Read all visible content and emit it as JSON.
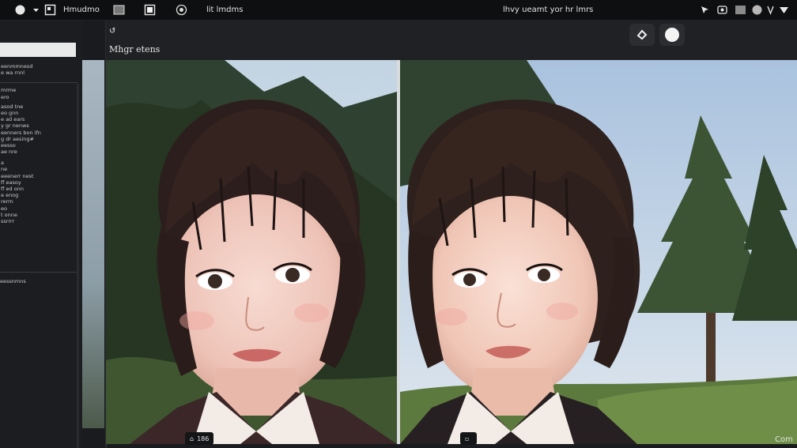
{
  "menubar": {
    "items": [
      "Hmudmo",
      "lit lmdms"
    ],
    "center_text": "lhvy ueamt yor hr lmrs",
    "icons": [
      "app-logo-icon",
      "dropdown-arrow-icon",
      "file-icon",
      "window-icon",
      "frame-icon",
      "target-icon",
      "cursor-icon",
      "camera-icon",
      "battery-icon",
      "sync-icon",
      "wifi-icon",
      "chevron-icon"
    ]
  },
  "left_panel": {
    "search_value": "",
    "groups": [
      [
        "eenmmnesd",
        "e wa rnnl"
      ],
      [
        "mrme",
        "ero"
      ],
      [
        "asod tne",
        "eo gnn",
        "e ad ears",
        "y gr nenws",
        "eenners bon ifn",
        "g dr aesing#",
        "eesso",
        "ae nre"
      ],
      [
        "a",
        "ne",
        "eeenerr nest",
        "ff easoy",
        "ff ed onn",
        "e enog",
        "rerrn",
        "eo",
        "t onne",
        "ssrrrr"
      ]
    ],
    "footer": "eessnmns"
  },
  "canvas": {
    "header_icon": "undo-icon",
    "title": "Mhgr etens",
    "buttons": [
      "eraser-icon",
      "circle-icon"
    ]
  },
  "status": {
    "left_chip": "186",
    "right_chip": "",
    "corner_label": "Com"
  },
  "colors": {
    "chrome_dark": "#0e0f10",
    "panel": "#1c1d20",
    "canvas_bg": "#1a1b1e",
    "header": "#202124",
    "divider": "#d9dbde"
  }
}
